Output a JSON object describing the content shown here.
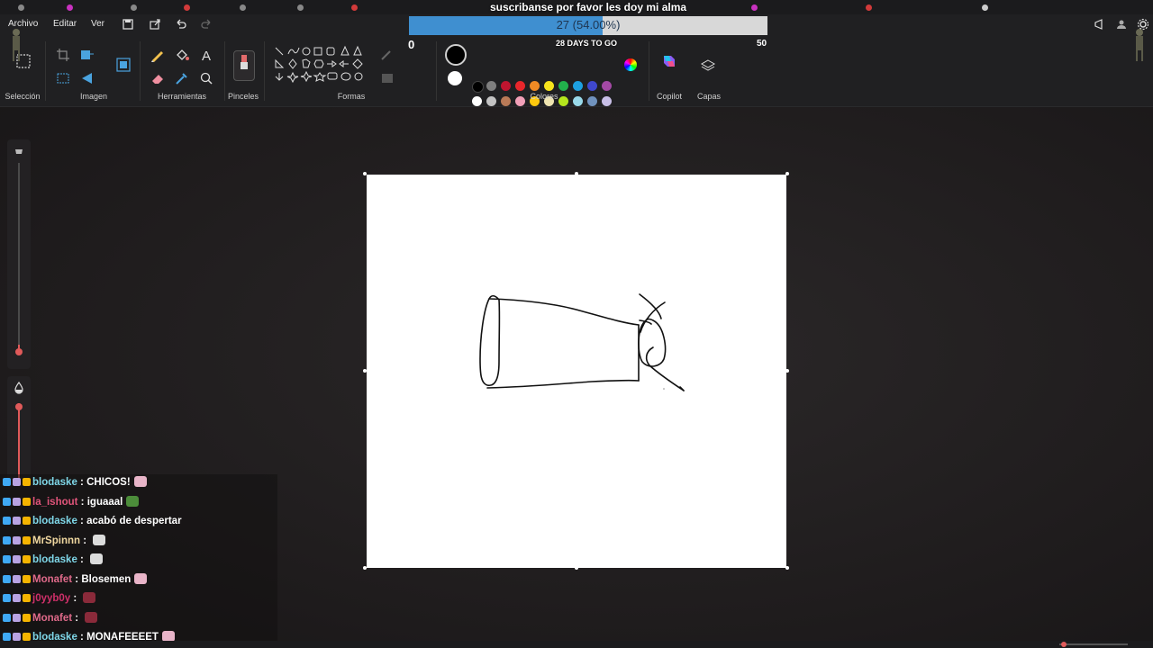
{
  "menu": {
    "file": "Archivo",
    "edit": "Editar",
    "view": "Ver"
  },
  "groups": {
    "selection": "Selección",
    "image": "Imagen",
    "tools": "Herramientas",
    "brushes": "Pinceles",
    "shapes": "Formas",
    "colors": "Colores",
    "copilot": "Copilot",
    "layers": "Capas"
  },
  "goal": {
    "title": "suscribanse por favor les doy mi alma",
    "progress_text": "27 (54.00%)",
    "progress_fraction": 0.54,
    "subtitle": "28 DAYS TO GO",
    "min": "0",
    "max": "50"
  },
  "palette": {
    "row1": [
      "#000000",
      "#7f7f7f",
      "#c0152f",
      "#e8262b",
      "#f08a24",
      "#f7e41c",
      "#22b14c",
      "#1da0e1",
      "#3f48cc",
      "#a349a4"
    ],
    "row2": [
      "#ffffff",
      "#c3c3c3",
      "#b97a57",
      "#f2a0b8",
      "#ffc90e",
      "#efe4b0",
      "#b5e61d",
      "#99d9ea",
      "#7092be",
      "#c8bfe7"
    ],
    "accent": "#3f8fd0"
  },
  "chat": [
    {
      "user": "blodaske",
      "color": "#7fd7e8",
      "sep": " : ",
      "msg": "CHICOS!",
      "emote": "#e8b4c8"
    },
    {
      "user": "la_ishout",
      "color": "#e0547a",
      "sep": " : ",
      "msg": "iguaaal",
      "emote": "#4c8c3a"
    },
    {
      "user": "blodaske",
      "color": "#7fd7e8",
      "sep": " : ",
      "msg": "acabó de despertar",
      "emote": ""
    },
    {
      "user": "MrSpinnn",
      "color": "#f0d8a0",
      "sep": " : ",
      "msg": "",
      "emote": "#dcdcdc"
    },
    {
      "user": "blodaske",
      "color": "#7fd7e8",
      "sep": " : ",
      "msg": "",
      "emote": "#dcdcdc"
    },
    {
      "user": "Monafet",
      "color": "#e06a8a",
      "sep": " : ",
      "msg": "Blosemen",
      "emote": "#e8b4c8"
    },
    {
      "user": "j0yyb0y",
      "color": "#d0306a",
      "sep": " : ",
      "msg": "",
      "emote": "#8a2a3a"
    },
    {
      "user": "Monafet",
      "color": "#e06a8a",
      "sep": " : ",
      "msg": "",
      "emote": "#8a2a3a"
    },
    {
      "user": "blodaske",
      "color": "#7fd7e8",
      "sep": " : ",
      "msg": "MONAFEEEET",
      "emote": "#e8b4c8"
    }
  ]
}
